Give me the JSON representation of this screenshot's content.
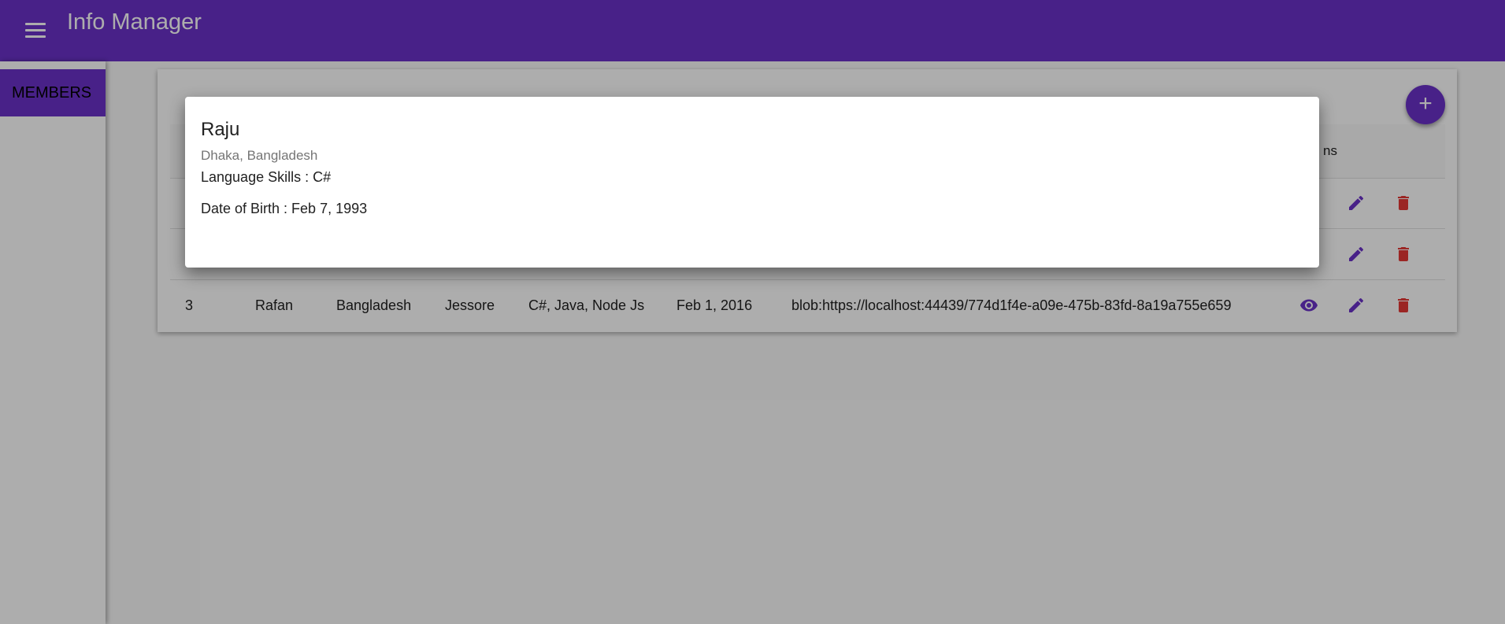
{
  "app": {
    "title": "Info Manager"
  },
  "sidebar": {
    "items": [
      {
        "label": "MEMBERS"
      }
    ]
  },
  "colors": {
    "primary": "#6a32c9",
    "delete": "#e53935",
    "overlay": "rgba(0,0,0,0.32)"
  },
  "table": {
    "headers": {
      "actions": "ns"
    },
    "rows": [
      {
        "id": "",
        "name": "",
        "country": "",
        "city": "",
        "skills": "",
        "date": "",
        "photo": ""
      },
      {
        "id": "",
        "name": "",
        "country": "",
        "city": "",
        "skills": "",
        "date": "",
        "photo": ""
      },
      {
        "id": "3",
        "name": "Rafan",
        "country": "Bangladesh",
        "city": "Jessore",
        "skills": "C#, Java, Node Js",
        "date": "Feb 1, 2016",
        "photo": "blob:https://localhost:44439/774d1f4e-a09e-475b-83fd-8a19a755e659"
      }
    ]
  },
  "icons": {
    "menu": "menu-icon",
    "add": "plus-icon",
    "view": "eye-icon",
    "edit": "pencil-icon",
    "delete": "trash-icon"
  },
  "dialog": {
    "name": "Raju",
    "location": "Dhaka, Bangladesh",
    "skills": "Language Skills : C#",
    "dob": "Date of Birth : Feb 7, 1993"
  }
}
